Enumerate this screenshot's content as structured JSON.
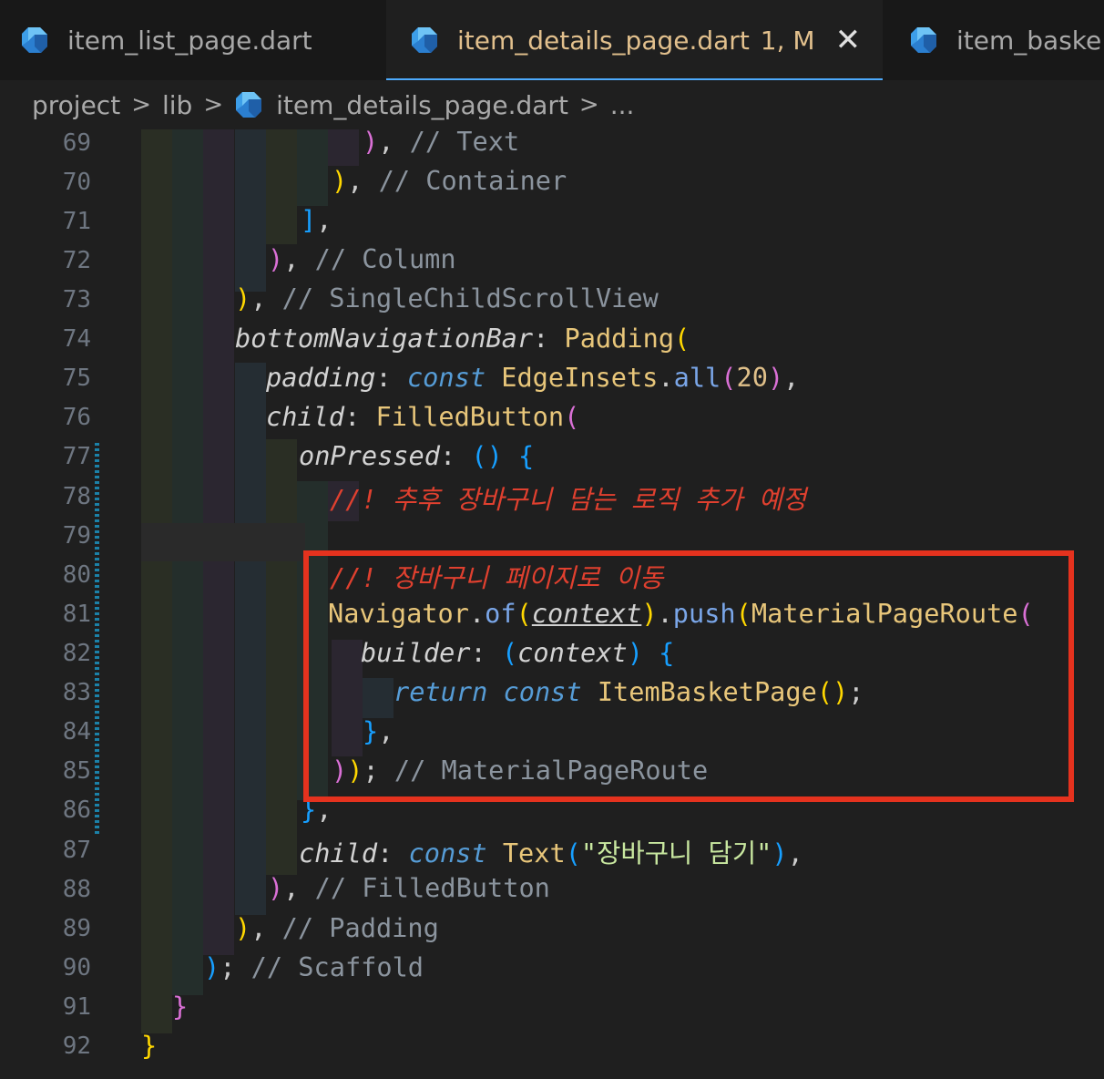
{
  "tabs": [
    {
      "label": "item_list_page.dart",
      "icon": "dart-icon"
    },
    {
      "label": "item_details_page.dart",
      "status": "1, M",
      "icon": "dart-icon",
      "active": true
    },
    {
      "label": "item_baske",
      "icon": "dart-icon"
    }
  ],
  "breadcrumb": {
    "items": [
      "project",
      "lib",
      "item_details_page.dart",
      "..."
    ],
    "separator": ">"
  },
  "editor": {
    "line_numbers": [
      "69",
      "70",
      "71",
      "72",
      "73",
      "74",
      "75",
      "76",
      "77",
      "78",
      "79",
      "80",
      "81",
      "82",
      "83",
      "84",
      "85",
      "86",
      "87",
      "88",
      "89",
      "90",
      "91",
      "92"
    ],
    "code": {
      "l69": {
        "p": ")",
        "s": ",",
        "c": "// Text"
      },
      "l70": {
        "p": ")",
        "s": ",",
        "c": "// Container"
      },
      "l71": {
        "p": "]",
        "s": ","
      },
      "l72": {
        "p": ")",
        "s": ",",
        "c": "// Column"
      },
      "l73": {
        "p": ")",
        "s": ",",
        "c": "// SingleChildScrollView"
      },
      "l74": {
        "prop": "bottomNavigationBar",
        "colon": ":",
        "cls": "Padding",
        "p": "("
      },
      "l75": {
        "prop": "padding",
        "colon": ":",
        "kw": "const",
        "cls": "EdgeInsets",
        "dot": ".",
        "meth": "all",
        "p1": "(",
        "num": "20",
        "p2": ")",
        "s": ","
      },
      "l76": {
        "prop": "child",
        "colon": ":",
        "cls": "FilledButton",
        "p": "("
      },
      "l77": {
        "prop": "onPressed",
        "colon": ":",
        "p1": "()",
        "p2": "{"
      },
      "l78": {
        "todo": "//! 추후 장바구니 담는 로직 추가 예정"
      },
      "l80": {
        "todo": "//! 장바구니 페이지로 이동"
      },
      "l81": {
        "cls1": "Navigator",
        "dot1": ".",
        "meth1": "of",
        "p1": "(",
        "arg": "context",
        "p2": ")",
        "dot2": ".",
        "meth2": "push",
        "p3": "(",
        "cls2": "MaterialPageRoute",
        "p4": "("
      },
      "l82": {
        "prop": "builder",
        "colon": ":",
        "p1": "(",
        "arg": "context",
        "p2": ")",
        "p3": "{"
      },
      "l83": {
        "kw1": "return",
        "kw2": "const",
        "cls": "ItemBasketPage",
        "p": "()",
        "s": ";"
      },
      "l84": {
        "p": "}",
        "s": ","
      },
      "l85": {
        "p1": ")",
        "p2": ")",
        "s": ";",
        "c": "// MaterialPageRoute"
      },
      "l86": {
        "p": "}",
        "s": ","
      },
      "l87": {
        "prop": "child",
        "colon": ":",
        "kw": "const",
        "cls": "Text",
        "p1": "(",
        "str": "\"장바구니 담기\"",
        "p2": ")",
        "s": ","
      },
      "l88": {
        "p": ")",
        "s": ",",
        "c": "// FilledButton"
      },
      "l89": {
        "p": ")",
        "s": ",",
        "c": "// Padding"
      },
      "l90": {
        "p": ")",
        "s": ";",
        "c": "// Scaffold"
      },
      "l91": {
        "p": "}"
      },
      "l92": {
        "p": "}"
      }
    },
    "highlight_color": "#e5321e"
  },
  "colors": {
    "background": "#1f1f1f",
    "tab_active_text": "#e2c08d",
    "comment_todo": "#e0402f",
    "accent": "#4daafc"
  }
}
